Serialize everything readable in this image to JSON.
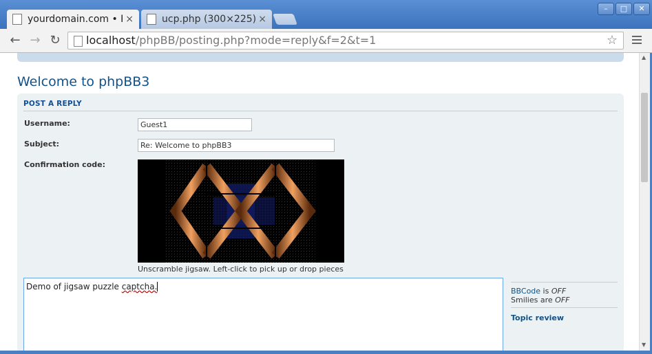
{
  "browser": {
    "tabs": [
      {
        "title": "yourdomain.com • Po",
        "close": "×"
      },
      {
        "title": "ucp.php (300×225)",
        "close": "×"
      }
    ],
    "url_host": "localhost",
    "url_rest": "/phpBB/posting.php?mode=reply&f=2&t=1",
    "window_controls": [
      "–",
      "□",
      "✕"
    ]
  },
  "page": {
    "title": "Welcome to phpBB3",
    "panel_title": "POST A REPLY",
    "username_label": "Username:",
    "username_value": "Guest1",
    "subject_label": "Subject:",
    "subject_value": "Re: Welcome to phpBB3",
    "confirm_label": "Confirmation code:",
    "captcha_hint": "Unscramble jigsaw. Left-click to pick up or drop pieces",
    "message_text": "Demo of jigsaw puzzle ",
    "message_misspelled": "captcha.",
    "bbcode_link": "BBCode",
    "bbcode_is": " is ",
    "bbcode_state": "OFF",
    "smilies_text": "Smilies are ",
    "smilies_state": "OFF",
    "topic_review": "Topic review"
  },
  "colors": {
    "accent": "#105289",
    "panel": "#ecf1f3"
  }
}
